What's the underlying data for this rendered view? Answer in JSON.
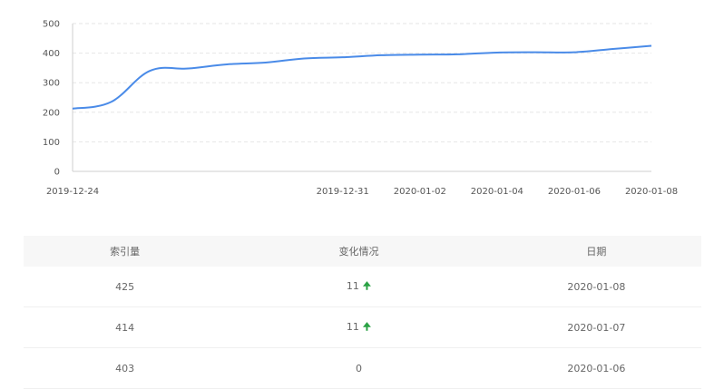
{
  "chart_data": {
    "type": "line",
    "x": [
      "2019-12-24",
      "2019-12-25",
      "2019-12-26",
      "2019-12-27",
      "2019-12-28",
      "2019-12-29",
      "2019-12-30",
      "2019-12-31",
      "2020-01-01",
      "2020-01-02",
      "2020-01-03",
      "2020-01-04",
      "2020-01-05",
      "2020-01-06",
      "2020-01-07",
      "2020-01-08"
    ],
    "xticks": [
      "2019-12-24",
      "2019-12-31",
      "2020-01-02",
      "2020-01-04",
      "2020-01-06",
      "2020-01-08"
    ],
    "series": [
      {
        "values": [
          212,
          235,
          340,
          348,
          362,
          368,
          382,
          386,
          393,
          395,
          396,
          402,
          403,
          403,
          414,
          425
        ]
      }
    ],
    "yticks": [
      0,
      100,
      200,
      300,
      400,
      500
    ],
    "ylim": [
      0,
      500
    ],
    "grid": true,
    "color": "#4a8be8"
  },
  "table": {
    "headers": [
      "索引量",
      "变化情况",
      "日期"
    ],
    "rows": [
      {
        "count": "425",
        "change": "11",
        "trend": "up",
        "date": "2020-01-08"
      },
      {
        "count": "414",
        "change": "11",
        "trend": "up",
        "date": "2020-01-07"
      },
      {
        "count": "403",
        "change": "0",
        "trend": "none",
        "date": "2020-01-06"
      }
    ],
    "up_arrow": "🠉",
    "up_color": "#2ba245"
  }
}
